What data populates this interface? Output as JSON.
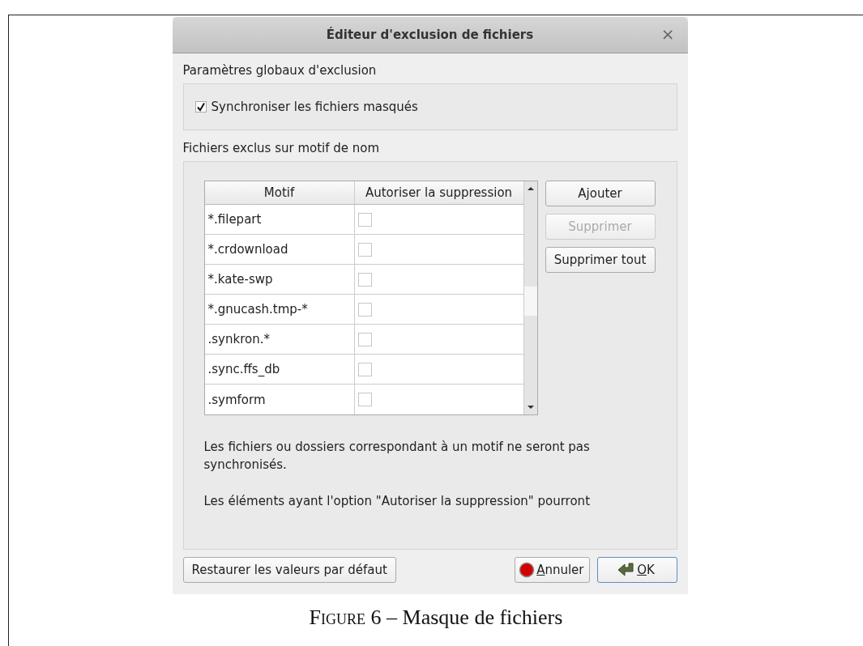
{
  "window": {
    "title": "Éditeur d'exclusion de fichiers",
    "close": "×"
  },
  "global_settings": {
    "title": "Paramètres globaux d'exclusion",
    "checkbox": {
      "label": "Synchroniser les fichiers masqués",
      "checked": true
    }
  },
  "patterns": {
    "title": "Fichiers exclus sur motif de nom",
    "table": {
      "columns": [
        "Motif",
        "Autoriser la suppression"
      ],
      "rows": [
        {
          "pattern": "*.filepart",
          "allow_delete": false
        },
        {
          "pattern": "*.crdownload",
          "allow_delete": false
        },
        {
          "pattern": "*.kate-swp",
          "allow_delete": false
        },
        {
          "pattern": "*.gnucash.tmp-*",
          "allow_delete": false
        },
        {
          "pattern": ".synkron.*",
          "allow_delete": false
        },
        {
          "pattern": ".sync.ffs_db",
          "allow_delete": false
        },
        {
          "pattern": ".symform",
          "allow_delete": false
        }
      ]
    },
    "buttons": [
      {
        "label": "Ajouter",
        "disabled": false
      },
      {
        "label": "Supprimer",
        "disabled": true
      },
      {
        "label": "Supprimer tout",
        "disabled": false
      }
    ],
    "notes": [
      "Les fichiers ou dossiers correspondant à un motif ne seront pas synchronisés.",
      "Les éléments ayant l'option \"Autoriser la suppression\" pourront"
    ]
  },
  "footer": {
    "restore": "Restaurer les valeurs par défaut",
    "cancel": {
      "mnemonic": "A",
      "rest": "nnuler"
    },
    "ok": {
      "mnemonic": "O",
      "rest": "K"
    }
  },
  "caption": {
    "label": "Figure",
    "text": "6 – Masque de fichiers"
  }
}
